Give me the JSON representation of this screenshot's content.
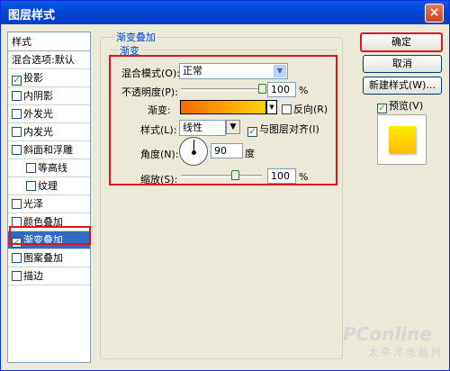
{
  "window": {
    "title": "图层样式",
    "close": "×"
  },
  "sidebar": {
    "header": "样式",
    "items": [
      {
        "label": "混合选项:默认",
        "checkbox": false,
        "checked": false
      },
      {
        "label": "投影",
        "checkbox": true,
        "checked": true
      },
      {
        "label": "内阴影",
        "checkbox": true,
        "checked": false
      },
      {
        "label": "外发光",
        "checkbox": true,
        "checked": false
      },
      {
        "label": "内发光",
        "checkbox": true,
        "checked": false
      },
      {
        "label": "斜面和浮雕",
        "checkbox": true,
        "checked": false
      },
      {
        "label": "等高线",
        "checkbox": true,
        "checked": false
      },
      {
        "label": "纹理",
        "checkbox": true,
        "checked": false
      },
      {
        "label": "光泽",
        "checkbox": true,
        "checked": false
      },
      {
        "label": "颜色叠加",
        "checkbox": true,
        "checked": false
      },
      {
        "label": "渐变叠加",
        "checkbox": true,
        "checked": true
      },
      {
        "label": "图案叠加",
        "checkbox": true,
        "checked": false
      },
      {
        "label": "描边",
        "checkbox": true,
        "checked": false
      }
    ]
  },
  "panel": {
    "title": "渐变叠加",
    "section": "渐变",
    "blend_label": "混合模式(O):",
    "blend_value": "正常",
    "opacity_label": "不透明度(P):",
    "opacity_value": "100",
    "opacity_unit": "%",
    "opacity_level": 100,
    "gradient_label": "渐变:",
    "reverse_label": "反向(R)",
    "style_label": "样式(L):",
    "style_value": "线性",
    "align_label": "与图层对齐(I)",
    "angle_label": "角度(N):",
    "angle_value": "90",
    "angle_unit": "度",
    "scale_label": "缩放(S):",
    "scale_value": "100",
    "scale_unit": "%",
    "scale_level": 100,
    "gradient_colors": [
      "#ff6a00",
      "#ffd200"
    ]
  },
  "buttons": {
    "ok": "确定",
    "cancel": "取消",
    "new_style": "新建样式(W)...",
    "preview": "预览(V)"
  },
  "watermark": {
    "brand": "PConline",
    "sub": "太平洋电脑网"
  },
  "colors": {
    "selection": "#316ac5",
    "highlight": "#e0151b",
    "group_title": "#0046d5",
    "preview_fill": "#ffd500"
  }
}
